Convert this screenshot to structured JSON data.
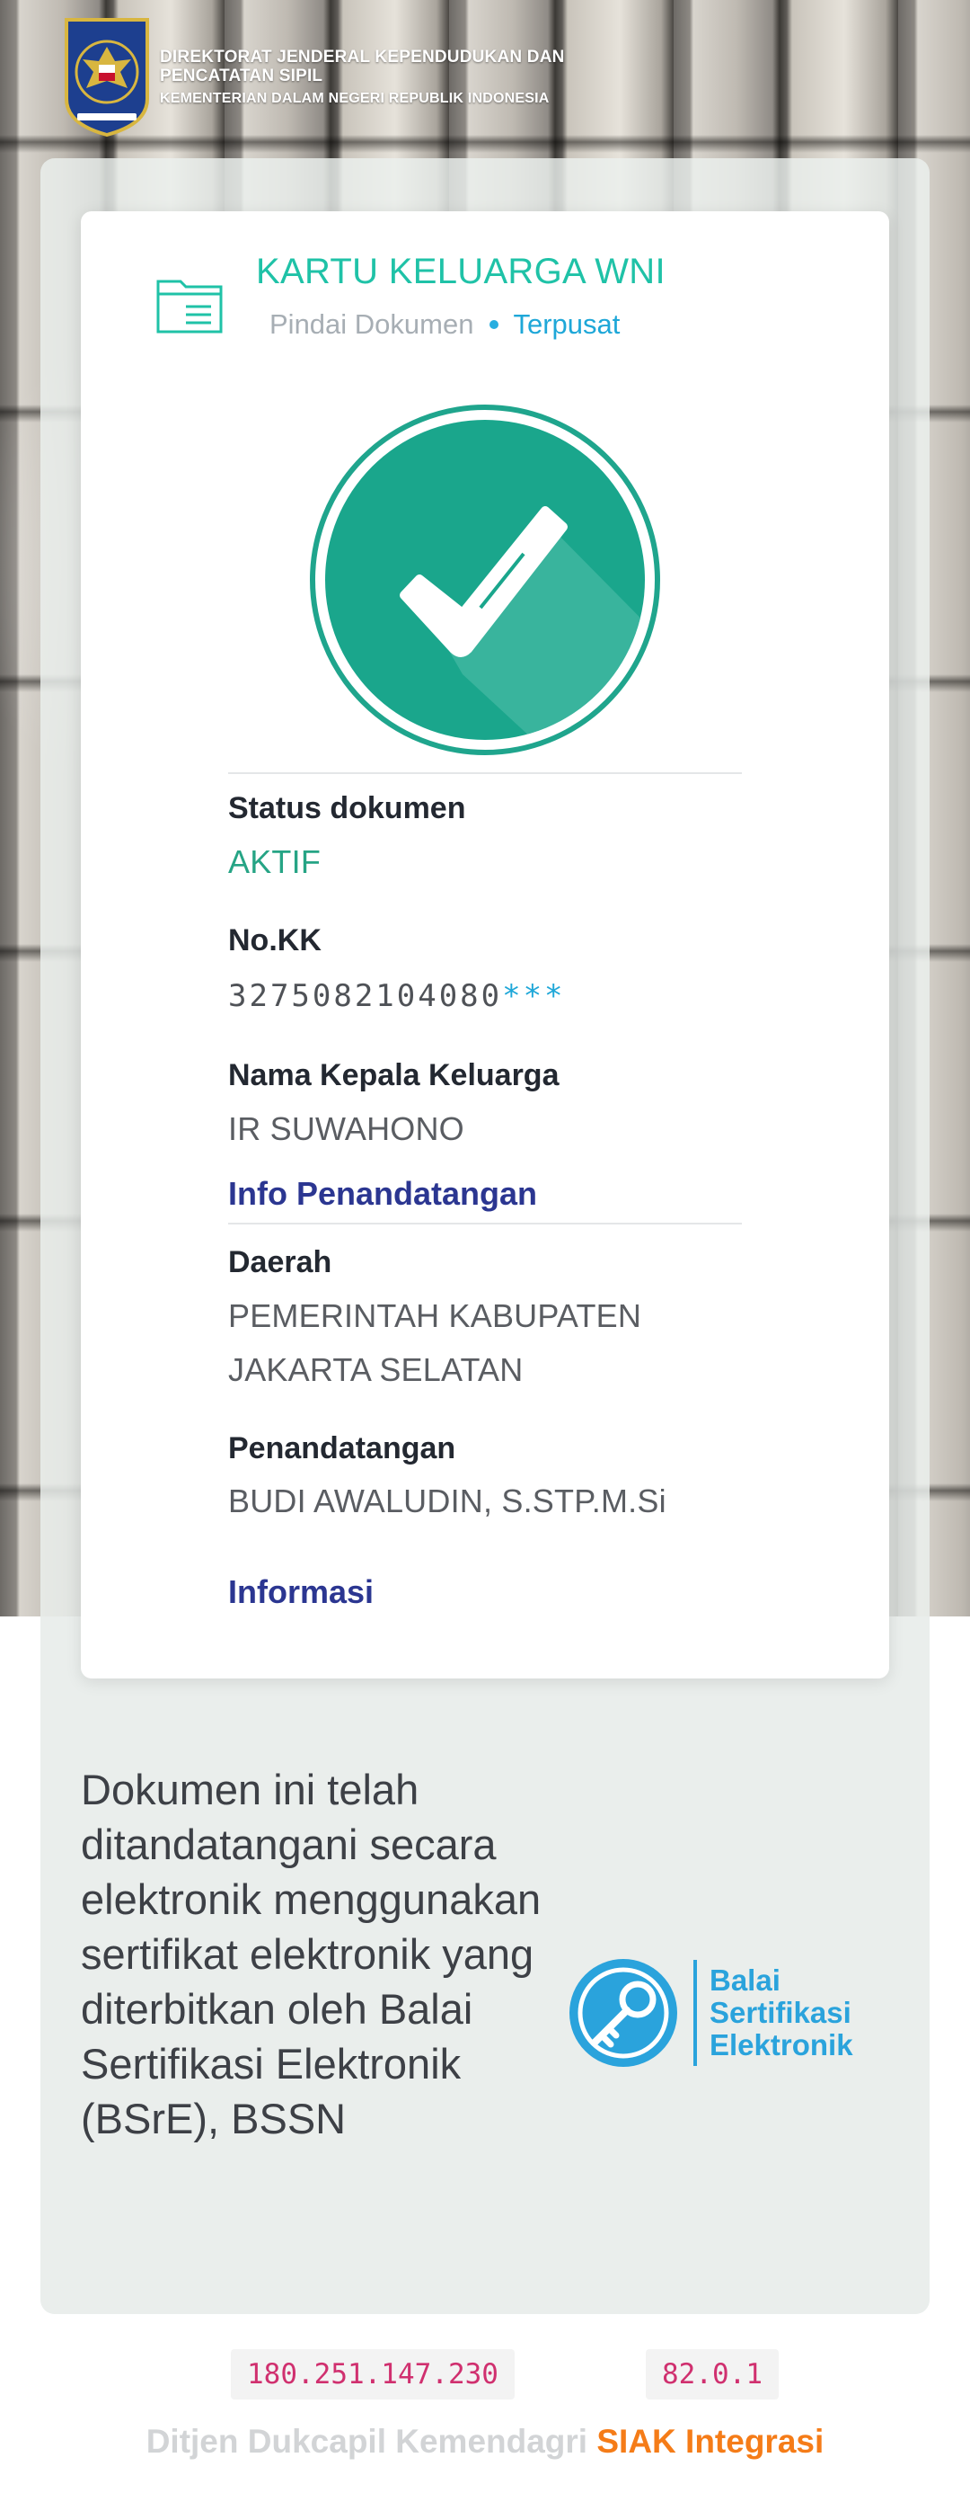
{
  "header": {
    "agency_line1": "DIREKTORAT JENDERAL KEPENDUDUKAN DAN PENCATATAN SIPIL",
    "agency_line2": "KEMENTERIAN DALAM NEGERI REPUBLIK INDONESIA",
    "emblem_icon": "garuda-emblem-icon"
  },
  "card": {
    "title": "KARTU KELUARGA WNI",
    "subtitle_left": "Pindai Dokumen",
    "subtitle_right": "Terpusat",
    "status_icon": "checkmark-circle-icon",
    "fields": {
      "status_label": "Status dokumen",
      "status_value": "AKTIF",
      "kk_label": "No.KK",
      "kk_value_visible": "3275082104080",
      "kk_value_masked": "***",
      "head_label": "Nama Kepala Keluarga",
      "head_value": "IR SUWAHONO"
    },
    "signer_section_title": "Info Penandatangan",
    "signer": {
      "region_label": "Daerah",
      "region_value_line1": "PEMERINTAH KABUPATEN",
      "region_value_line2": "JAKARTA SELATAN",
      "signer_label": "Penandatangan",
      "signer_value": "BUDI AWALUDIN, S.STP.M.Si"
    },
    "info_link": "Informasi"
  },
  "statement": "Dokumen ini telah ditandatangani secara elektronik menggunakan sertifikat elektronik yang diterbitkan oleh Balai Sertifikasi Elektronik (BSrE), BSSN",
  "bsre_logo": {
    "line1": "Balai",
    "line2": "Sertifikasi",
    "line3": "Elektronik",
    "icon": "key-seal-icon"
  },
  "footer": {
    "ip_badge": "180.251.147.230",
    "version_badge": "82.0.1",
    "credit_left": "Ditjen Dukcapil Kemendagri",
    "credit_right": "SIAK Integrasi"
  },
  "colors": {
    "teal": "#1fc2a7",
    "green_status": "#26a485",
    "link_blue": "#2b3691",
    "accent_blue": "#1ea7d8",
    "orange": "#f57c18"
  }
}
